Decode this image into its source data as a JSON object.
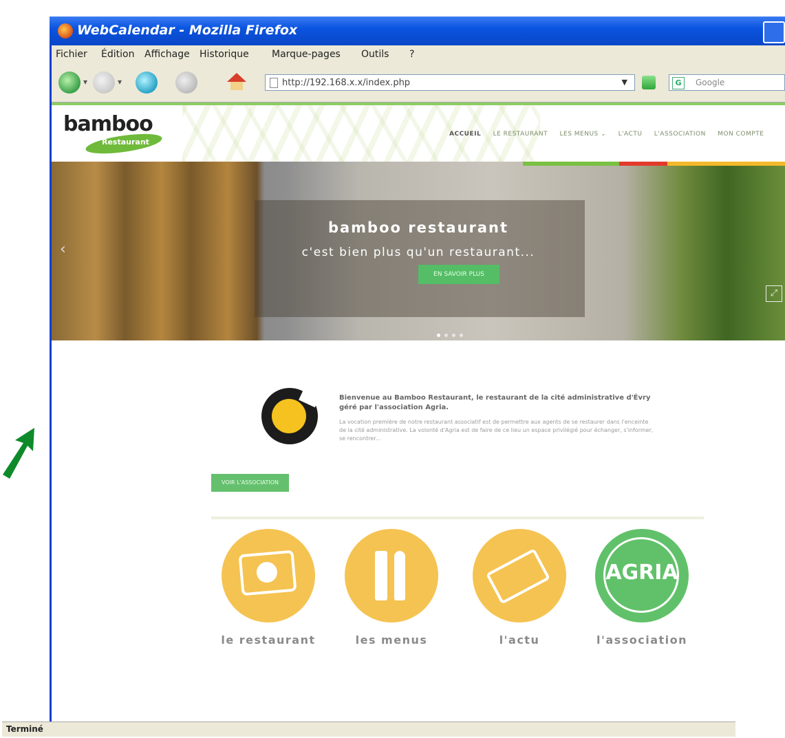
{
  "browser": {
    "title": "WebCalendar - Mozilla Firefox",
    "menu": [
      "Fichier",
      "Édition",
      "Affichage",
      "Historique",
      "Marque-pages",
      "Outils",
      "?"
    ],
    "url": "http://192.168.x.x/index.php",
    "search_placeholder": "Google",
    "status": "Terminé"
  },
  "site": {
    "logo_word": "bamboo",
    "logo_sub": "Restaurant",
    "nav": [
      "ACCUEIL",
      "LE RESTAURANT",
      "LES MENUS ⌄",
      "L'ACTU",
      "L'ASSOCIATION",
      "MON COMPTE"
    ],
    "hero": {
      "title": "bamboo restaurant",
      "subtitle": "c'est bien plus qu'un restaurant...",
      "button": "EN SAVOIR PLUS"
    },
    "welcome": {
      "lead": "Bienvenue au Bamboo Restaurant, le restaurant de la cité administrative d'Évry géré par l'association Agria.",
      "body": "La vocation première de notre restaurant associatif est de permettre aux agents de se restaurer dans l'enceinte de la cité administrative. La volonté d'Agria est de faire de ce lieu un espace privilégié pour échanger, s'informer, se rencontrer..."
    },
    "read_more": "VOIR L'ASSOCIATION",
    "tiles": [
      {
        "label": "le restaurant",
        "color": "#f5c351"
      },
      {
        "label": "les menus",
        "color": "#f5c351"
      },
      {
        "label": "l'actu",
        "color": "#f5c351"
      },
      {
        "label": "l'association",
        "color": "#61c16a",
        "icon_text": "AGRIA"
      }
    ]
  },
  "colors": {
    "accent_green": "#65c06e",
    "accent_yellow": "#f5c351",
    "title_blue": "#0b54e0"
  }
}
